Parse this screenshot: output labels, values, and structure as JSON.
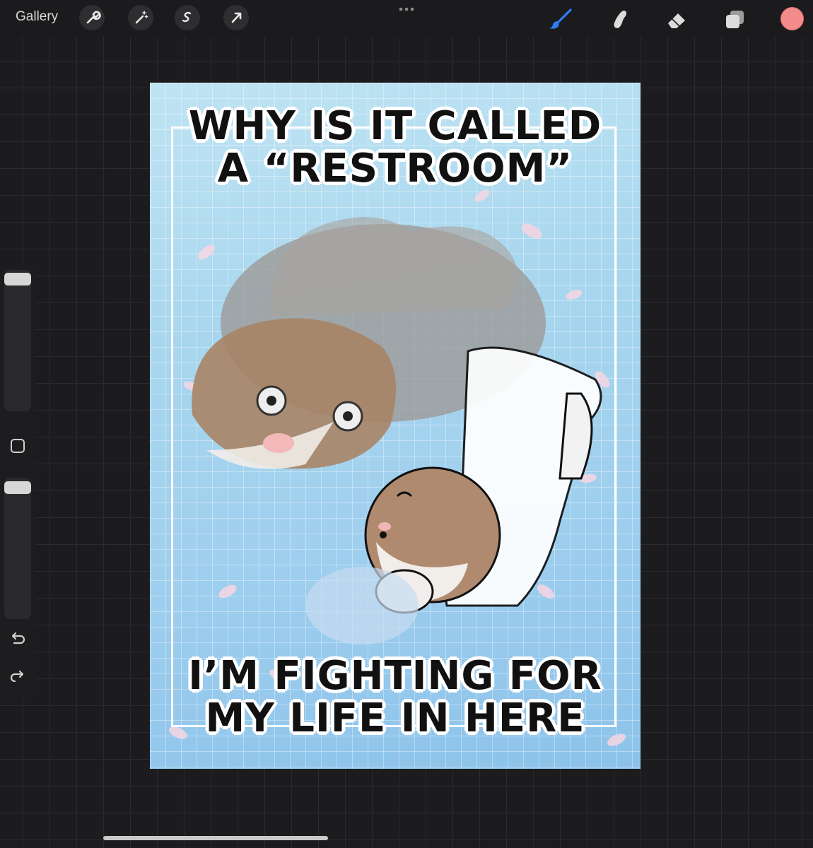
{
  "toolbar": {
    "gallery_label": "Gallery",
    "left_tools": [
      "wrench-icon",
      "magic-wand-icon",
      "selection-s-icon",
      "transform-arrow-icon"
    ],
    "right_tools": [
      "brush-icon",
      "smudge-icon",
      "eraser-icon",
      "layers-icon"
    ],
    "active_tool": "brush-icon",
    "active_color": "#f48b8b",
    "accent_color": "#2f7cf6"
  },
  "sidebar": {
    "controls": [
      "brush-size-slider",
      "modify-square-button",
      "opacity-slider",
      "undo-icon",
      "redo-icon"
    ]
  },
  "artwork": {
    "top_line_1": "WHY IS IT CALLED",
    "top_line_2": "A “RESTROOM”",
    "bottom_line_1": "I’M FIGHTING FOR",
    "bottom_line_2": "MY LIFE IN HERE"
  }
}
